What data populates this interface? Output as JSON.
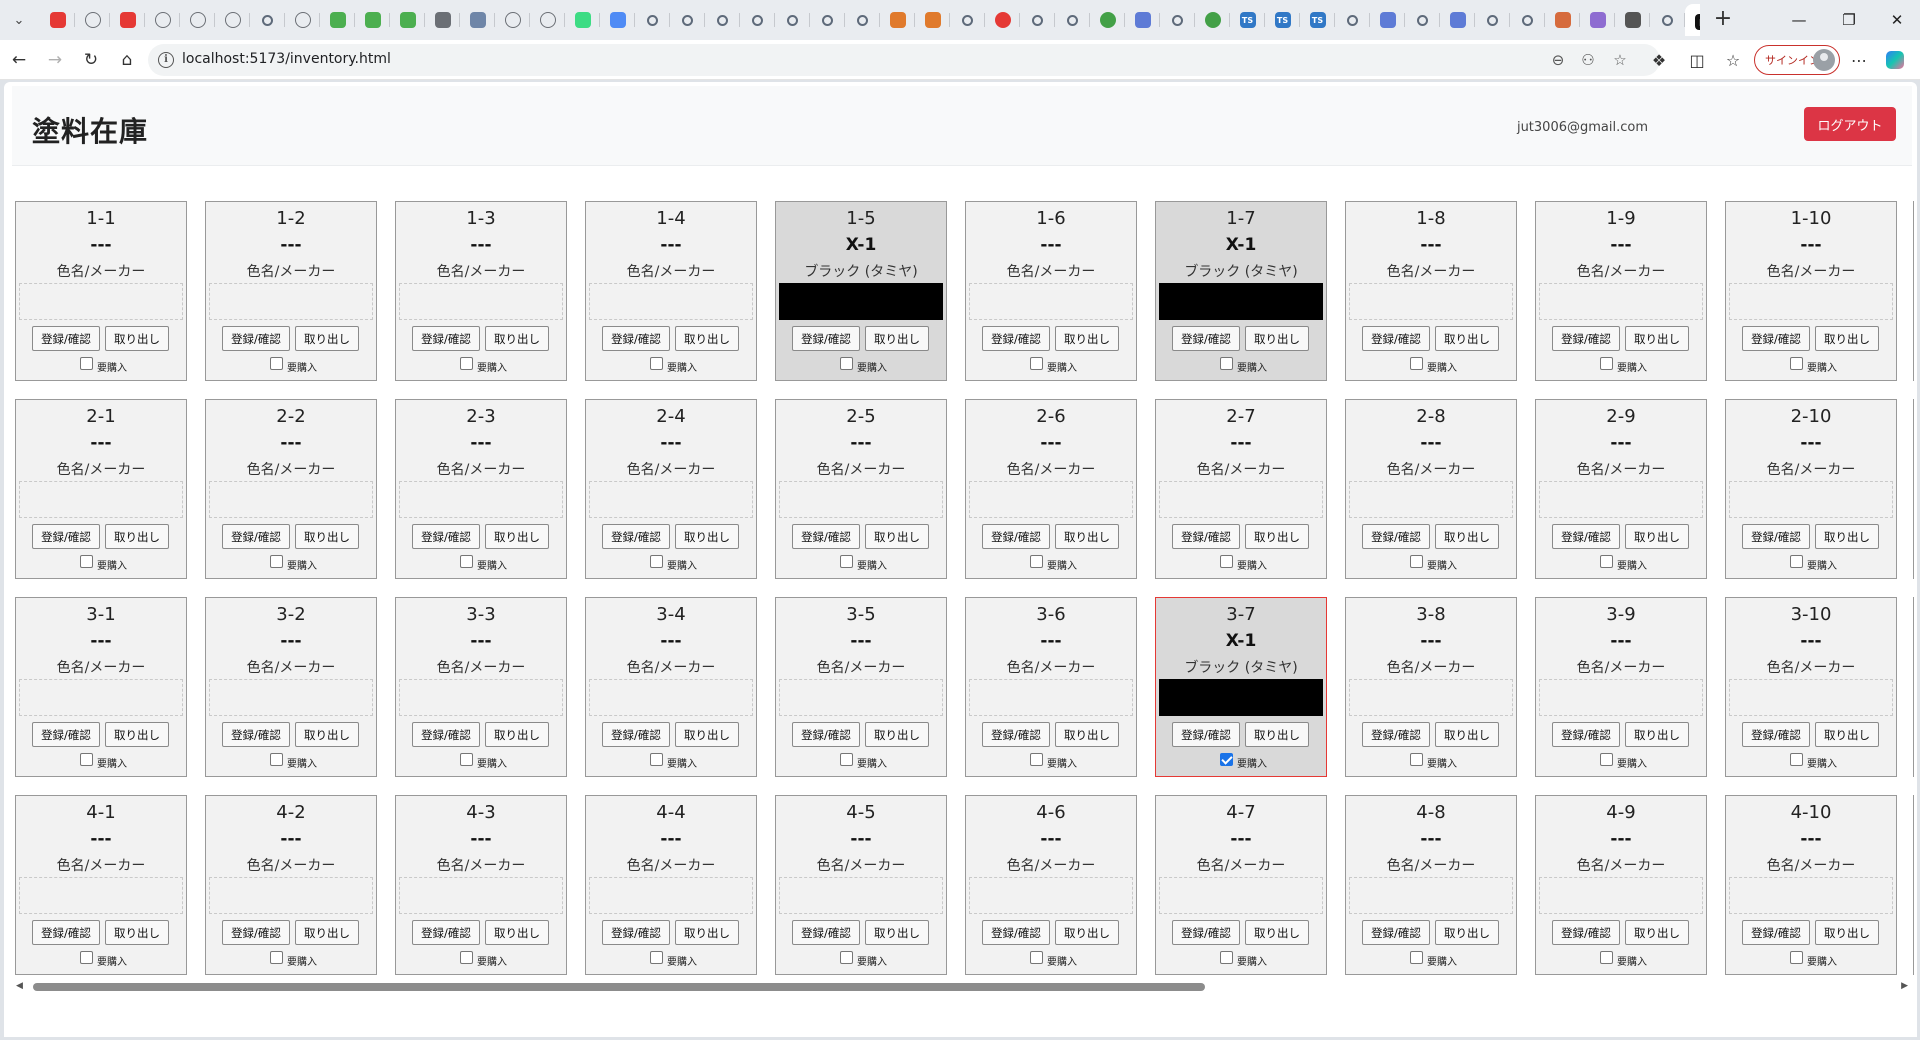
{
  "browser": {
    "active_tab_favicon": "n",
    "url": "localhost:5173/inventory.html",
    "signin_label": "サインイン",
    "tab_favicons": [
      "youtube",
      "globe",
      "youtube",
      "globe",
      "globe",
      "globe",
      "search",
      "globe",
      "puzzle",
      "puzzle",
      "puzzle",
      "gear",
      "cube",
      "globe",
      "globe",
      "android",
      "gemini",
      "search",
      "search",
      "search",
      "search",
      "search",
      "search",
      "search",
      "feather",
      "feather",
      "search",
      "flame",
      "search",
      "search",
      "green-circle",
      "pen",
      "search",
      "green-circle",
      "ts",
      "ts",
      "ts",
      "search",
      "pen",
      "search",
      "pen",
      "search",
      "search",
      "crab",
      "image",
      "hand",
      "search"
    ]
  },
  "app": {
    "title": "塗料在庫",
    "user_email": "jut3006@gmail.com",
    "logout_label": "ログアウト"
  },
  "labels": {
    "register": "登録/確認",
    "takeout": "取り出し",
    "need_purchase": "要購入",
    "empty_code": "---",
    "empty_name": "色名/メーカー"
  },
  "colors": {
    "filled_bg": "#d9d9d9",
    "empty_bg": "#f2f2f2",
    "alert_border": "#e53935",
    "logout_red": "#dc3545",
    "swatch_black": "#000000"
  },
  "inventory": {
    "rows": 4,
    "cols": 10,
    "cells": {
      "1-5": {
        "code": "X-1",
        "name": "ブラック (タミヤ)",
        "swatch": "#000000"
      },
      "1-7": {
        "code": "X-1",
        "name": "ブラック (タミヤ)",
        "swatch": "#000000"
      },
      "3-7": {
        "code": "X-1",
        "name": "ブラック (タミヤ)",
        "swatch": "#000000",
        "need_purchase": true
      }
    }
  }
}
